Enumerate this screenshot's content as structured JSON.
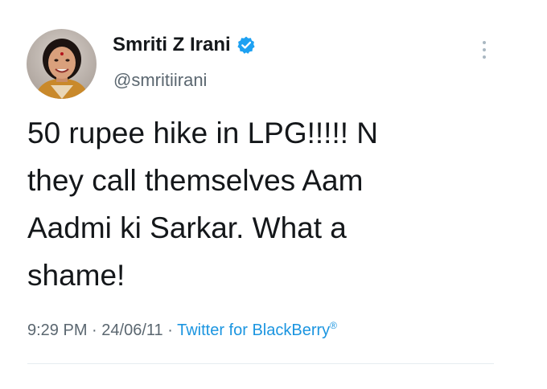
{
  "account": {
    "display_name": "Smriti Z Irani",
    "handle": "@smritiirani",
    "verified": true,
    "verified_icon": "verified-badge",
    "verified_color": "#1da1f2"
  },
  "tweet": {
    "text": "50 rupee hike in LPG!!!!! N\nthey call themselves Aam\nAadmi ki Sarkar. What a\nshame!",
    "time": "9:29 PM",
    "date": "24/06/11",
    "separator": "·",
    "source": "Twitter for BlackBerry",
    "source_mark": "®",
    "source_color": "#1b95e0"
  },
  "menu": {
    "icon": "more-vertical-icon"
  }
}
